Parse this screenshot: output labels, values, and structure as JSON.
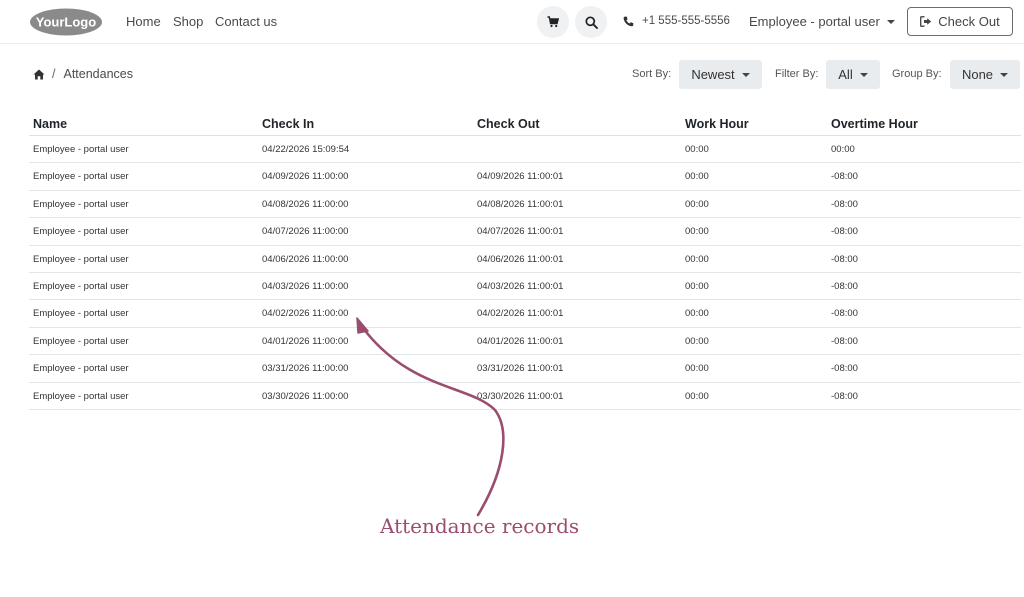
{
  "navbar": {
    "logo_text": "YourLogo",
    "links": [
      "Home",
      "Shop",
      "Contact us"
    ],
    "phone": "+1 555-555-5556",
    "user": "Employee - portal user",
    "checkout_label": "Check Out"
  },
  "toolbar": {
    "breadcrumb_current": "Attendances",
    "breadcrumb_separator": "/",
    "sort_label": "Sort By:",
    "sort_value": "Newest",
    "filter_label": "Filter By:",
    "filter_value": "All",
    "group_label": "Group By:",
    "group_value": "None"
  },
  "table": {
    "headers": [
      "Name",
      "Check In",
      "Check Out",
      "Work Hour",
      "Overtime Hour"
    ],
    "rows": [
      [
        "Employee - portal user",
        "04/22/2026 15:09:54",
        "",
        "00:00",
        "00:00"
      ],
      [
        "Employee - portal user",
        "04/09/2026 11:00:00",
        "04/09/2026 11:00:01",
        "00:00",
        "-08:00"
      ],
      [
        "Employee - portal user",
        "04/08/2026 11:00:00",
        "04/08/2026 11:00:01",
        "00:00",
        "-08:00"
      ],
      [
        "Employee - portal user",
        "04/07/2026 11:00:00",
        "04/07/2026 11:00:01",
        "00:00",
        "-08:00"
      ],
      [
        "Employee - portal user",
        "04/06/2026 11:00:00",
        "04/06/2026 11:00:01",
        "00:00",
        "-08:00"
      ],
      [
        "Employee - portal user",
        "04/03/2026 11:00:00",
        "04/03/2026 11:00:01",
        "00:00",
        "-08:00"
      ],
      [
        "Employee - portal user",
        "04/02/2026 11:00:00",
        "04/02/2026 11:00:01",
        "00:00",
        "-08:00"
      ],
      [
        "Employee - portal user",
        "04/01/2026 11:00:00",
        "04/01/2026 11:00:01",
        "00:00",
        "-08:00"
      ],
      [
        "Employee - portal user",
        "03/31/2026 11:00:00",
        "03/31/2026 11:00:01",
        "00:00",
        "-08:00"
      ],
      [
        "Employee - portal user",
        "03/30/2026 11:00:00",
        "03/30/2026 11:00:01",
        "00:00",
        "-08:00"
      ]
    ]
  },
  "annotation": {
    "text": "Attendance records",
    "color": "#9a4d6e"
  },
  "icons": {
    "cart": "cart-icon",
    "search": "search-icon",
    "phone": "phone-icon",
    "checkout": "sign-out-icon",
    "home": "home-icon"
  }
}
